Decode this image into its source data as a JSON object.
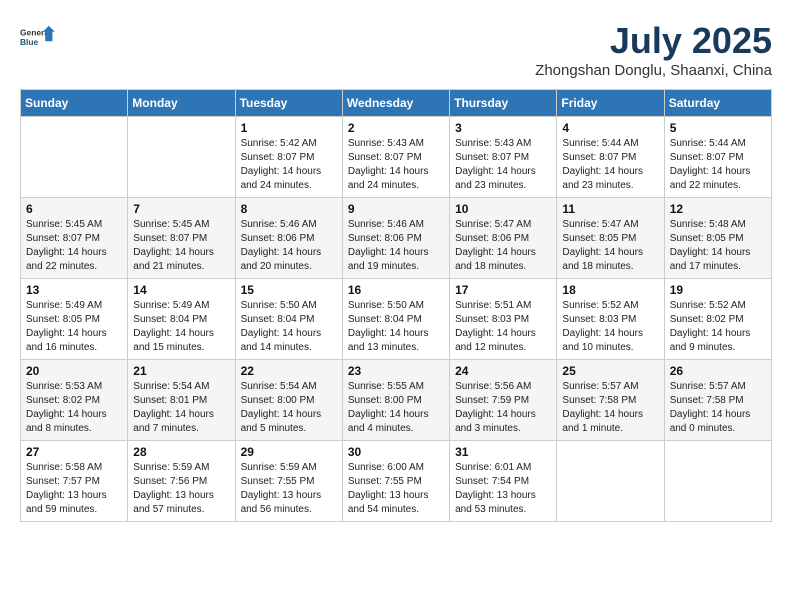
{
  "header": {
    "logo_general": "General",
    "logo_blue": "Blue",
    "month": "July 2025",
    "location": "Zhongshan Donglu, Shaanxi, China"
  },
  "columns": [
    "Sunday",
    "Monday",
    "Tuesday",
    "Wednesday",
    "Thursday",
    "Friday",
    "Saturday"
  ],
  "weeks": [
    [
      {
        "day": "",
        "info": ""
      },
      {
        "day": "",
        "info": ""
      },
      {
        "day": "1",
        "info": "Sunrise: 5:42 AM\nSunset: 8:07 PM\nDaylight: 14 hours and 24 minutes."
      },
      {
        "day": "2",
        "info": "Sunrise: 5:43 AM\nSunset: 8:07 PM\nDaylight: 14 hours and 24 minutes."
      },
      {
        "day": "3",
        "info": "Sunrise: 5:43 AM\nSunset: 8:07 PM\nDaylight: 14 hours and 23 minutes."
      },
      {
        "day": "4",
        "info": "Sunrise: 5:44 AM\nSunset: 8:07 PM\nDaylight: 14 hours and 23 minutes."
      },
      {
        "day": "5",
        "info": "Sunrise: 5:44 AM\nSunset: 8:07 PM\nDaylight: 14 hours and 22 minutes."
      }
    ],
    [
      {
        "day": "6",
        "info": "Sunrise: 5:45 AM\nSunset: 8:07 PM\nDaylight: 14 hours and 22 minutes."
      },
      {
        "day": "7",
        "info": "Sunrise: 5:45 AM\nSunset: 8:07 PM\nDaylight: 14 hours and 21 minutes."
      },
      {
        "day": "8",
        "info": "Sunrise: 5:46 AM\nSunset: 8:06 PM\nDaylight: 14 hours and 20 minutes."
      },
      {
        "day": "9",
        "info": "Sunrise: 5:46 AM\nSunset: 8:06 PM\nDaylight: 14 hours and 19 minutes."
      },
      {
        "day": "10",
        "info": "Sunrise: 5:47 AM\nSunset: 8:06 PM\nDaylight: 14 hours and 18 minutes."
      },
      {
        "day": "11",
        "info": "Sunrise: 5:47 AM\nSunset: 8:05 PM\nDaylight: 14 hours and 18 minutes."
      },
      {
        "day": "12",
        "info": "Sunrise: 5:48 AM\nSunset: 8:05 PM\nDaylight: 14 hours and 17 minutes."
      }
    ],
    [
      {
        "day": "13",
        "info": "Sunrise: 5:49 AM\nSunset: 8:05 PM\nDaylight: 14 hours and 16 minutes."
      },
      {
        "day": "14",
        "info": "Sunrise: 5:49 AM\nSunset: 8:04 PM\nDaylight: 14 hours and 15 minutes."
      },
      {
        "day": "15",
        "info": "Sunrise: 5:50 AM\nSunset: 8:04 PM\nDaylight: 14 hours and 14 minutes."
      },
      {
        "day": "16",
        "info": "Sunrise: 5:50 AM\nSunset: 8:04 PM\nDaylight: 14 hours and 13 minutes."
      },
      {
        "day": "17",
        "info": "Sunrise: 5:51 AM\nSunset: 8:03 PM\nDaylight: 14 hours and 12 minutes."
      },
      {
        "day": "18",
        "info": "Sunrise: 5:52 AM\nSunset: 8:03 PM\nDaylight: 14 hours and 10 minutes."
      },
      {
        "day": "19",
        "info": "Sunrise: 5:52 AM\nSunset: 8:02 PM\nDaylight: 14 hours and 9 minutes."
      }
    ],
    [
      {
        "day": "20",
        "info": "Sunrise: 5:53 AM\nSunset: 8:02 PM\nDaylight: 14 hours and 8 minutes."
      },
      {
        "day": "21",
        "info": "Sunrise: 5:54 AM\nSunset: 8:01 PM\nDaylight: 14 hours and 7 minutes."
      },
      {
        "day": "22",
        "info": "Sunrise: 5:54 AM\nSunset: 8:00 PM\nDaylight: 14 hours and 5 minutes."
      },
      {
        "day": "23",
        "info": "Sunrise: 5:55 AM\nSunset: 8:00 PM\nDaylight: 14 hours and 4 minutes."
      },
      {
        "day": "24",
        "info": "Sunrise: 5:56 AM\nSunset: 7:59 PM\nDaylight: 14 hours and 3 minutes."
      },
      {
        "day": "25",
        "info": "Sunrise: 5:57 AM\nSunset: 7:58 PM\nDaylight: 14 hours and 1 minute."
      },
      {
        "day": "26",
        "info": "Sunrise: 5:57 AM\nSunset: 7:58 PM\nDaylight: 14 hours and 0 minutes."
      }
    ],
    [
      {
        "day": "27",
        "info": "Sunrise: 5:58 AM\nSunset: 7:57 PM\nDaylight: 13 hours and 59 minutes."
      },
      {
        "day": "28",
        "info": "Sunrise: 5:59 AM\nSunset: 7:56 PM\nDaylight: 13 hours and 57 minutes."
      },
      {
        "day": "29",
        "info": "Sunrise: 5:59 AM\nSunset: 7:55 PM\nDaylight: 13 hours and 56 minutes."
      },
      {
        "day": "30",
        "info": "Sunrise: 6:00 AM\nSunset: 7:55 PM\nDaylight: 13 hours and 54 minutes."
      },
      {
        "day": "31",
        "info": "Sunrise: 6:01 AM\nSunset: 7:54 PM\nDaylight: 13 hours and 53 minutes."
      },
      {
        "day": "",
        "info": ""
      },
      {
        "day": "",
        "info": ""
      }
    ]
  ]
}
